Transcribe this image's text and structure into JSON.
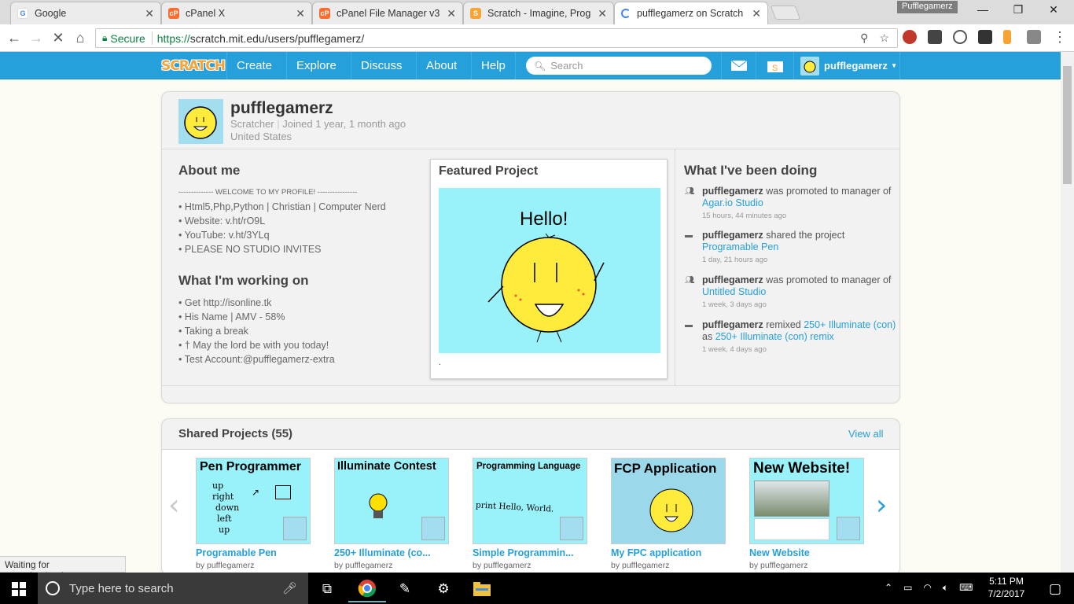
{
  "browser": {
    "tabs": [
      {
        "title": "Google",
        "favicon_color": "#4285f4",
        "favicon_letter": "G"
      },
      {
        "title": "cPanel X",
        "favicon_color": "#ff6c2c",
        "favicon_letter": "cP"
      },
      {
        "title": "cPanel File Manager v3",
        "favicon_color": "#ff6c2c",
        "favicon_letter": "cP"
      },
      {
        "title": "Scratch - Imagine, Progra",
        "favicon_color": "#f7a434",
        "favicon_letter": "S"
      },
      {
        "title": "pufflegamerz on Scratch",
        "favicon_color": "#ffffff",
        "favicon_letter": ""
      }
    ],
    "profile_name": "Pufflegamerz",
    "url_secure": "Secure",
    "url_protocol": "https://",
    "url_rest": "scratch.mit.edu/users/pufflegamerz/",
    "status_text": "Waiting for scratch.mit.edu..."
  },
  "nav": {
    "logo": "SCRATCH",
    "links": [
      "Create",
      "Explore",
      "Discuss",
      "About",
      "Help"
    ],
    "search_placeholder": "Search",
    "username": "pufflegamerz"
  },
  "profile": {
    "username": "pufflegamerz",
    "rank": "Scratcher",
    "joined": "Joined 1 year, 1 month ago",
    "location": "United States",
    "about_heading": "About me",
    "about_lines": [
      "--------------    WELCOME TO MY PROFILE!   ----------------",
      "• Html5,Php,Python | Christian | Computer Nerd",
      "• Website: v.ht/rO9L",
      "• YouTube: v.ht/3YLq",
      "• PLEASE NO STUDIO INVITES"
    ],
    "working_heading": "What I'm working on",
    "working_lines": [
      "• Get http://isonline.tk",
      "• His Name | AMV - 58%",
      "• Taking a break",
      "• † May the lord be with you today!",
      "• Test Account:@pufflegamerz-extra"
    ],
    "featured_heading": "Featured Project",
    "featured_hello": "Hello!",
    "featured_caption": ".",
    "activity_heading": "What I've been doing",
    "activity": [
      {
        "user": "pufflegamerz",
        "pre": " was promoted to manager of ",
        "link": "Agar.io Studio",
        "mid": "",
        "link2": "",
        "time": "15 hours, 44 minutes ago",
        "icon": "studio-icon"
      },
      {
        "user": "pufflegamerz",
        "pre": " shared the project ",
        "link": "Programable Pen",
        "mid": "",
        "link2": "",
        "time": "1 day, 21 hours ago",
        "icon": "share-icon"
      },
      {
        "user": "pufflegamerz",
        "pre": " was promoted to manager of ",
        "link": "Untitled Studio",
        "mid": "",
        "link2": "",
        "time": "1 week, 3 days ago",
        "icon": "studio-icon"
      },
      {
        "user": "pufflegamerz",
        "pre": " remixed ",
        "link": "250+ Illuminate (con)",
        "mid": " as ",
        "link2": "250+ Illuminate (con) remix",
        "time": "1 week, 4 days ago",
        "icon": "remix-icon"
      }
    ]
  },
  "shared": {
    "title": "Shared Projects (55)",
    "view_all": "View all",
    "projects": [
      {
        "thumb_title": "Pen Programmer",
        "thumb_body": [
          "up",
          "right",
          "down",
          "left",
          "up"
        ],
        "title": "Programable Pen",
        "by": "by pufflegamerz"
      },
      {
        "thumb_title": "Illuminate Contest",
        "thumb_body": [],
        "title": "250+ Illuminate (co...",
        "by": "by pufflegamerz"
      },
      {
        "thumb_title": "Programming Language",
        "thumb_body": [
          "print Hello, World."
        ],
        "title": "Simple Programmin...",
        "by": "by pufflegamerz"
      },
      {
        "thumb_title": "FCP Application",
        "thumb_body": [],
        "title": "My FPC application",
        "by": "by pufflegamerz"
      },
      {
        "thumb_title": "New Website!",
        "thumb_body": [],
        "title": "New Website",
        "by": "by pufflegamerz"
      }
    ]
  },
  "taskbar": {
    "search_placeholder": "Type here to search",
    "time": "5:11 PM",
    "date": "7/2/2017"
  }
}
